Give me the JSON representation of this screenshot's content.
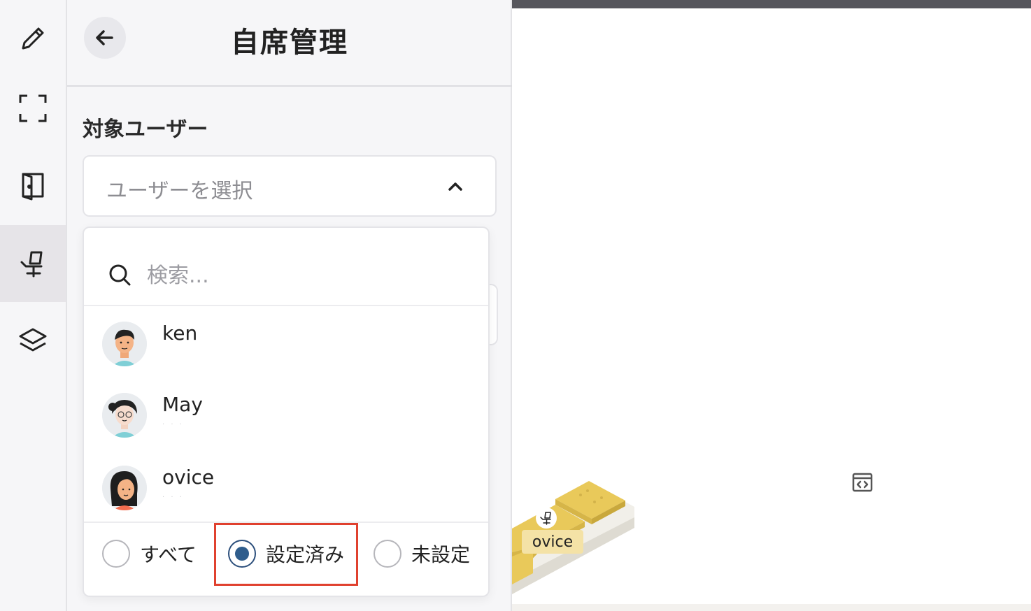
{
  "rail": {
    "items": [
      {
        "icon": "pencil-icon",
        "active": false
      },
      {
        "icon": "fullscreen-icon",
        "active": false
      },
      {
        "icon": "door-icon",
        "active": false
      },
      {
        "icon": "desk-chair-icon",
        "active": true
      },
      {
        "icon": "layers-icon",
        "active": false
      }
    ]
  },
  "panel": {
    "title": "自席管理",
    "section_label": "対象ユーザー",
    "select_placeholder": "ユーザーを選択"
  },
  "dropdown": {
    "search_placeholder": "検索...",
    "users": [
      {
        "name": "ken",
        "avatar": "man-avatar"
      },
      {
        "name": "May",
        "avatar": "woman-glasses-avatar"
      },
      {
        "name": "ovice",
        "avatar": "woman-avatar"
      }
    ],
    "filters": [
      {
        "label": "すべて",
        "checked": false
      },
      {
        "label": "設定済み",
        "checked": true
      },
      {
        "label": "未設定",
        "checked": false
      }
    ]
  },
  "map": {
    "desk_label": "ovice"
  },
  "colors": {
    "accent": "#2f5d8c",
    "highlight": "#e0412f",
    "desk": "#e8c75a"
  }
}
